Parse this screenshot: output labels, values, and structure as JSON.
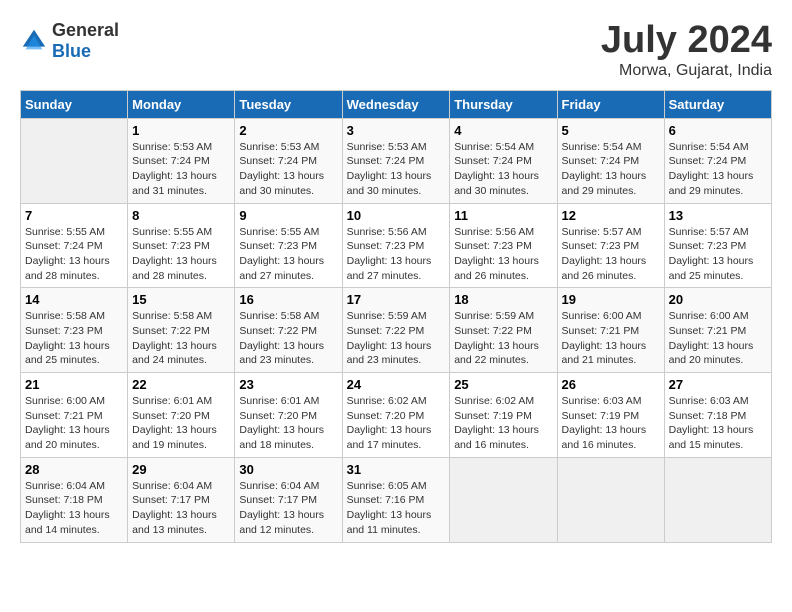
{
  "header": {
    "logo_general": "General",
    "logo_blue": "Blue",
    "title": "July 2024",
    "location": "Morwa, Gujarat, India"
  },
  "days_of_week": [
    "Sunday",
    "Monday",
    "Tuesday",
    "Wednesday",
    "Thursday",
    "Friday",
    "Saturday"
  ],
  "weeks": [
    [
      {
        "num": "",
        "sunrise": "",
        "sunset": "",
        "daylight": ""
      },
      {
        "num": "1",
        "sunrise": "Sunrise: 5:53 AM",
        "sunset": "Sunset: 7:24 PM",
        "daylight": "Daylight: 13 hours and 31 minutes."
      },
      {
        "num": "2",
        "sunrise": "Sunrise: 5:53 AM",
        "sunset": "Sunset: 7:24 PM",
        "daylight": "Daylight: 13 hours and 30 minutes."
      },
      {
        "num": "3",
        "sunrise": "Sunrise: 5:53 AM",
        "sunset": "Sunset: 7:24 PM",
        "daylight": "Daylight: 13 hours and 30 minutes."
      },
      {
        "num": "4",
        "sunrise": "Sunrise: 5:54 AM",
        "sunset": "Sunset: 7:24 PM",
        "daylight": "Daylight: 13 hours and 30 minutes."
      },
      {
        "num": "5",
        "sunrise": "Sunrise: 5:54 AM",
        "sunset": "Sunset: 7:24 PM",
        "daylight": "Daylight: 13 hours and 29 minutes."
      },
      {
        "num": "6",
        "sunrise": "Sunrise: 5:54 AM",
        "sunset": "Sunset: 7:24 PM",
        "daylight": "Daylight: 13 hours and 29 minutes."
      }
    ],
    [
      {
        "num": "7",
        "sunrise": "Sunrise: 5:55 AM",
        "sunset": "Sunset: 7:24 PM",
        "daylight": "Daylight: 13 hours and 28 minutes."
      },
      {
        "num": "8",
        "sunrise": "Sunrise: 5:55 AM",
        "sunset": "Sunset: 7:23 PM",
        "daylight": "Daylight: 13 hours and 28 minutes."
      },
      {
        "num": "9",
        "sunrise": "Sunrise: 5:55 AM",
        "sunset": "Sunset: 7:23 PM",
        "daylight": "Daylight: 13 hours and 27 minutes."
      },
      {
        "num": "10",
        "sunrise": "Sunrise: 5:56 AM",
        "sunset": "Sunset: 7:23 PM",
        "daylight": "Daylight: 13 hours and 27 minutes."
      },
      {
        "num": "11",
        "sunrise": "Sunrise: 5:56 AM",
        "sunset": "Sunset: 7:23 PM",
        "daylight": "Daylight: 13 hours and 26 minutes."
      },
      {
        "num": "12",
        "sunrise": "Sunrise: 5:57 AM",
        "sunset": "Sunset: 7:23 PM",
        "daylight": "Daylight: 13 hours and 26 minutes."
      },
      {
        "num": "13",
        "sunrise": "Sunrise: 5:57 AM",
        "sunset": "Sunset: 7:23 PM",
        "daylight": "Daylight: 13 hours and 25 minutes."
      }
    ],
    [
      {
        "num": "14",
        "sunrise": "Sunrise: 5:58 AM",
        "sunset": "Sunset: 7:23 PM",
        "daylight": "Daylight: 13 hours and 25 minutes."
      },
      {
        "num": "15",
        "sunrise": "Sunrise: 5:58 AM",
        "sunset": "Sunset: 7:22 PM",
        "daylight": "Daylight: 13 hours and 24 minutes."
      },
      {
        "num": "16",
        "sunrise": "Sunrise: 5:58 AM",
        "sunset": "Sunset: 7:22 PM",
        "daylight": "Daylight: 13 hours and 23 minutes."
      },
      {
        "num": "17",
        "sunrise": "Sunrise: 5:59 AM",
        "sunset": "Sunset: 7:22 PM",
        "daylight": "Daylight: 13 hours and 23 minutes."
      },
      {
        "num": "18",
        "sunrise": "Sunrise: 5:59 AM",
        "sunset": "Sunset: 7:22 PM",
        "daylight": "Daylight: 13 hours and 22 minutes."
      },
      {
        "num": "19",
        "sunrise": "Sunrise: 6:00 AM",
        "sunset": "Sunset: 7:21 PM",
        "daylight": "Daylight: 13 hours and 21 minutes."
      },
      {
        "num": "20",
        "sunrise": "Sunrise: 6:00 AM",
        "sunset": "Sunset: 7:21 PM",
        "daylight": "Daylight: 13 hours and 20 minutes."
      }
    ],
    [
      {
        "num": "21",
        "sunrise": "Sunrise: 6:00 AM",
        "sunset": "Sunset: 7:21 PM",
        "daylight": "Daylight: 13 hours and 20 minutes."
      },
      {
        "num": "22",
        "sunrise": "Sunrise: 6:01 AM",
        "sunset": "Sunset: 7:20 PM",
        "daylight": "Daylight: 13 hours and 19 minutes."
      },
      {
        "num": "23",
        "sunrise": "Sunrise: 6:01 AM",
        "sunset": "Sunset: 7:20 PM",
        "daylight": "Daylight: 13 hours and 18 minutes."
      },
      {
        "num": "24",
        "sunrise": "Sunrise: 6:02 AM",
        "sunset": "Sunset: 7:20 PM",
        "daylight": "Daylight: 13 hours and 17 minutes."
      },
      {
        "num": "25",
        "sunrise": "Sunrise: 6:02 AM",
        "sunset": "Sunset: 7:19 PM",
        "daylight": "Daylight: 13 hours and 16 minutes."
      },
      {
        "num": "26",
        "sunrise": "Sunrise: 6:03 AM",
        "sunset": "Sunset: 7:19 PM",
        "daylight": "Daylight: 13 hours and 16 minutes."
      },
      {
        "num": "27",
        "sunrise": "Sunrise: 6:03 AM",
        "sunset": "Sunset: 7:18 PM",
        "daylight": "Daylight: 13 hours and 15 minutes."
      }
    ],
    [
      {
        "num": "28",
        "sunrise": "Sunrise: 6:04 AM",
        "sunset": "Sunset: 7:18 PM",
        "daylight": "Daylight: 13 hours and 14 minutes."
      },
      {
        "num": "29",
        "sunrise": "Sunrise: 6:04 AM",
        "sunset": "Sunset: 7:17 PM",
        "daylight": "Daylight: 13 hours and 13 minutes."
      },
      {
        "num": "30",
        "sunrise": "Sunrise: 6:04 AM",
        "sunset": "Sunset: 7:17 PM",
        "daylight": "Daylight: 13 hours and 12 minutes."
      },
      {
        "num": "31",
        "sunrise": "Sunrise: 6:05 AM",
        "sunset": "Sunset: 7:16 PM",
        "daylight": "Daylight: 13 hours and 11 minutes."
      },
      {
        "num": "",
        "sunrise": "",
        "sunset": "",
        "daylight": ""
      },
      {
        "num": "",
        "sunrise": "",
        "sunset": "",
        "daylight": ""
      },
      {
        "num": "",
        "sunrise": "",
        "sunset": "",
        "daylight": ""
      }
    ]
  ]
}
